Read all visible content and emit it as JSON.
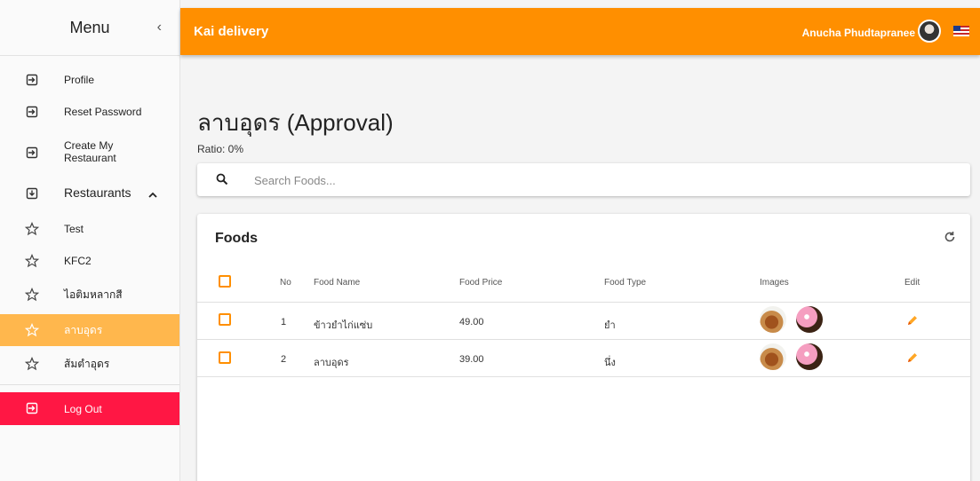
{
  "sidebar": {
    "title": "Menu",
    "collapse_icon": "‹",
    "items": [
      {
        "label": "Profile"
      },
      {
        "label": "Reset Password"
      },
      {
        "label": "Create My Restaurant"
      },
      {
        "label": "Restaurants"
      },
      {
        "label": "Test"
      },
      {
        "label": "KFC2"
      },
      {
        "label": "ไอติมหลากสี"
      },
      {
        "label": "ลาบอุดร"
      },
      {
        "label": "ส้มตำอุดร"
      }
    ],
    "logout_label": "Log Out"
  },
  "topbar": {
    "app_title": "Kai delivery",
    "user_name": "Anucha Phudtapranee"
  },
  "page": {
    "title": "ลาบอุดร (Approval)",
    "ratio": "Ratio: 0%"
  },
  "search": {
    "placeholder": "Search Foods..."
  },
  "foods": {
    "title": "Foods",
    "columns": {
      "no": "No",
      "name": "Food Name",
      "price": "Food Price",
      "type": "Food Type",
      "images": "Images",
      "edit": "Edit"
    },
    "rows": [
      {
        "no": "1",
        "name": "ข้าวยำไก่แซ่บ",
        "price": "49.00",
        "type": "ยำ"
      },
      {
        "no": "2",
        "name": "ลาบอุดร",
        "price": "39.00",
        "type": "นึ่ง"
      }
    ]
  },
  "colors": {
    "primary": "#ff8f00",
    "active": "#ffb74d",
    "logout": "#ff1744"
  },
  "icons": [
    "login-icon",
    "star-icon",
    "search-icon",
    "refresh-icon",
    "pencil-icon",
    "chevron-up-icon"
  ]
}
